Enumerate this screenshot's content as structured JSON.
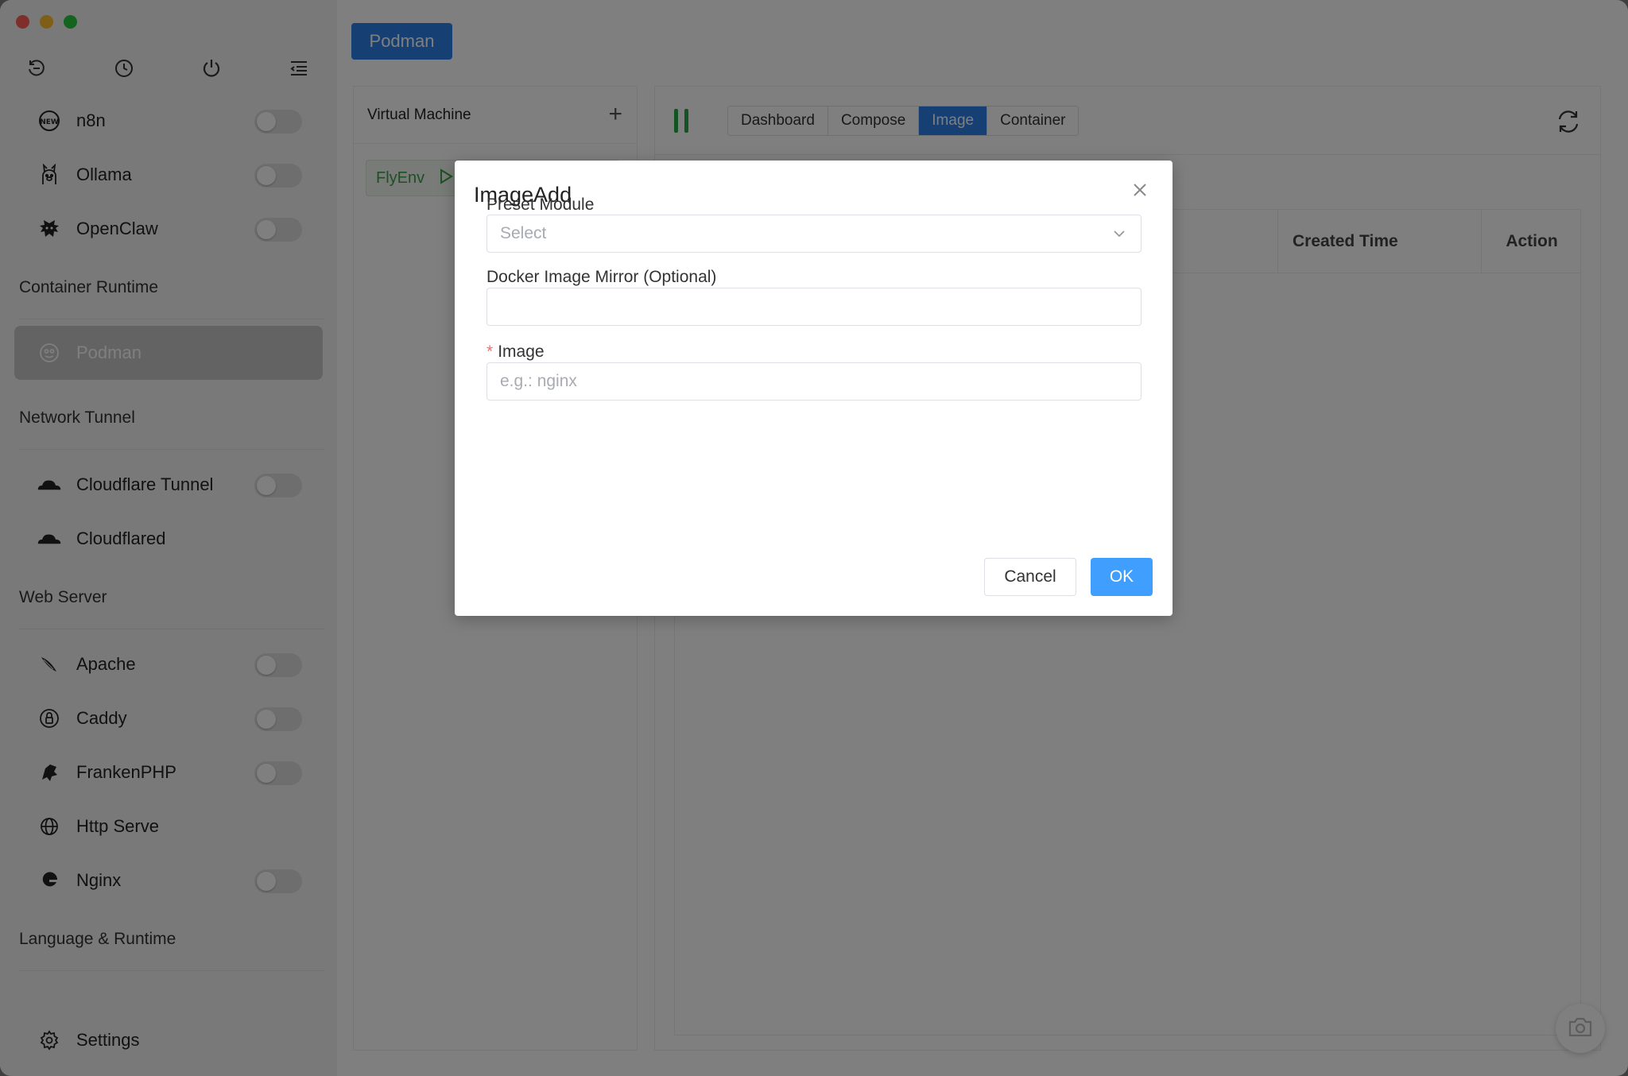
{
  "app": {
    "runtime_button": "Podman"
  },
  "sidebar": {
    "top_items": [
      {
        "label": "n8n",
        "icon": "n8n-icon",
        "toggle": false
      },
      {
        "label": "Ollama",
        "icon": "ollama-icon",
        "toggle": false
      },
      {
        "label": "OpenClaw",
        "icon": "openclaw-icon",
        "toggle": false
      }
    ],
    "sections": {
      "container_runtime": "Container Runtime",
      "network_tunnel": "Network Tunnel",
      "web_server": "Web Server",
      "language_runtime": "Language & Runtime"
    },
    "container_items": [
      {
        "label": "Podman",
        "icon": "podman-icon"
      }
    ],
    "tunnel_items": [
      {
        "label": "Cloudflare Tunnel",
        "icon": "cloudflare-icon",
        "toggle": false
      },
      {
        "label": "Cloudflared",
        "icon": "cloudflare-icon"
      }
    ],
    "web_items": [
      {
        "label": "Apache",
        "icon": "apache-feather-icon",
        "toggle": false
      },
      {
        "label": "Caddy",
        "icon": "caddy-icon",
        "toggle": false
      },
      {
        "label": "FrankenPHP",
        "icon": "frankenphp-icon",
        "toggle": false
      },
      {
        "label": "Http Serve",
        "icon": "globe-icon"
      },
      {
        "label": "Nginx",
        "icon": "nginx-icon",
        "toggle": false
      }
    ],
    "settings": "Settings"
  },
  "vm_panel": {
    "title": "Virtual Machine",
    "items": [
      {
        "name": "FlyEnv"
      }
    ]
  },
  "content": {
    "tabs": [
      "Dashboard",
      "Compose",
      "Image",
      "Container"
    ],
    "active_tab": "Image",
    "table_headers": {
      "created": "Created Time",
      "action": "Action"
    }
  },
  "modal": {
    "title": "ImageAdd",
    "preset_label": "Preset Module",
    "preset_placeholder": "Select",
    "mirror_label": "Docker Image Mirror (Optional)",
    "mirror_value": "",
    "image_label": "Image",
    "image_required_mark": "*",
    "image_placeholder": "e.g.: nginx",
    "cancel": "Cancel",
    "ok": "OK"
  },
  "colors": {
    "accent": "#2d7ee9",
    "ok_button": "#409eff",
    "running_green": "#28a745",
    "required_red": "#f56c6c"
  }
}
